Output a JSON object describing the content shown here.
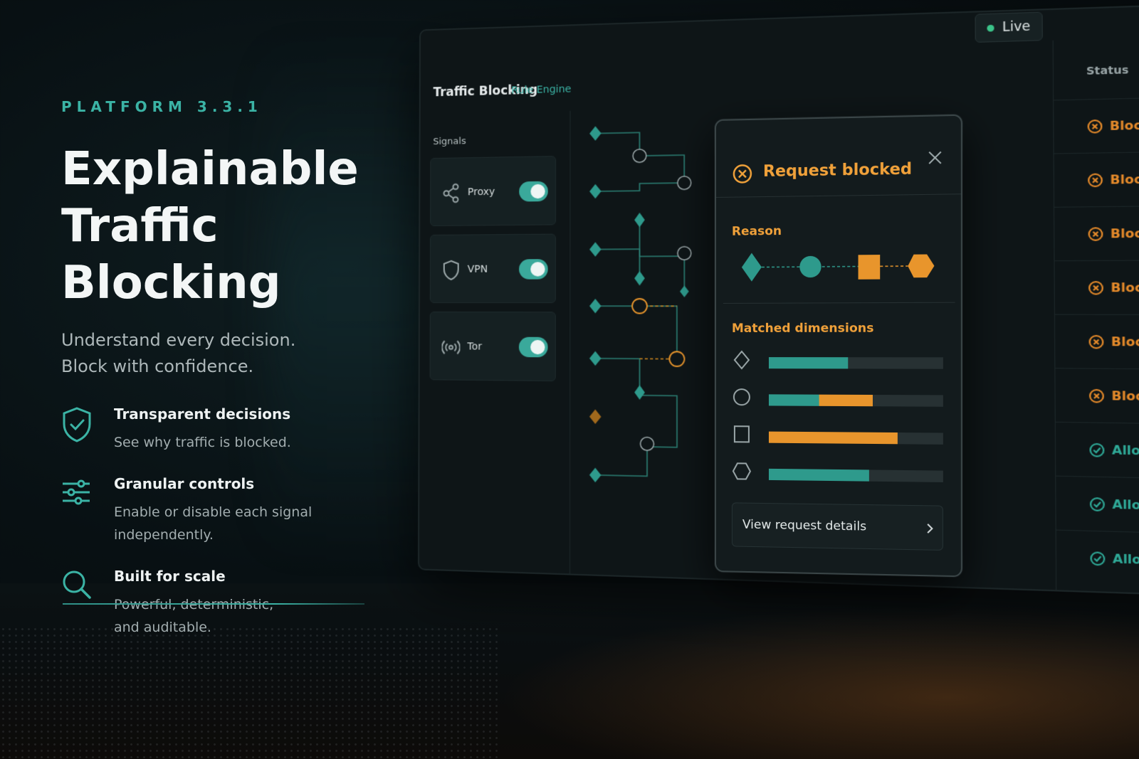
{
  "hero": {
    "version": "PLATFORM 3.3.1",
    "headline_1": "Explainable",
    "headline_2": "Traffic Blocking",
    "subline_1": "Understand every decision.",
    "subline_2": "Block with confidence.",
    "features": [
      {
        "icon": "shield-check-icon",
        "title": "Transparent decisions",
        "desc_1": "See why traffic is blocked.",
        "desc_2": ""
      },
      {
        "icon": "sliders-icon",
        "title": "Granular controls",
        "desc_1": "Enable or disable each signal",
        "desc_2": "independently."
      },
      {
        "icon": "search-icon",
        "title": "Built for scale",
        "desc_1": "Powerful, deterministic,",
        "desc_2": "and auditable."
      }
    ]
  },
  "app": {
    "title": "Traffic Blocking",
    "subtitle": "Rule Engine",
    "live_label": "Live",
    "signals_label": "Signals",
    "signals": [
      {
        "label": "Proxy",
        "icon": "share-icon",
        "enabled": true
      },
      {
        "label": "VPN",
        "icon": "shield-icon",
        "enabled": true
      },
      {
        "label": "Tor",
        "icon": "broadcast-icon",
        "enabled": true
      }
    ],
    "status_header": "Status",
    "statuses": [
      "Blocked",
      "Blocked",
      "Blocked",
      "Blocked",
      "Blocked",
      "Blocked",
      "Allowed",
      "Allowed",
      "Allowed"
    ]
  },
  "popup": {
    "title": "Request blocked",
    "reason_label": "Reason",
    "dimensions_label": "Matched dimensions",
    "dimensions": [
      {
        "shape": "diamond-icon",
        "segments": [
          {
            "fraction": 0.46,
            "color": "#2e9a8c"
          }
        ]
      },
      {
        "shape": "circle-icon",
        "segments": [
          {
            "fraction": 0.29,
            "color": "#2e9a8c"
          },
          {
            "fraction": 0.31,
            "color": "#e8952c"
          }
        ]
      },
      {
        "shape": "square-icon",
        "segments": [
          {
            "fraction": 0.74,
            "color": "#e8952c"
          }
        ]
      },
      {
        "shape": "hexagon-icon",
        "segments": [
          {
            "fraction": 0.58,
            "color": "#2e9a8c"
          }
        ]
      }
    ],
    "button_label": "View request details"
  },
  "colors": {
    "accent_teal": "#3bb3a5",
    "accent_orange": "#f0a13a"
  }
}
